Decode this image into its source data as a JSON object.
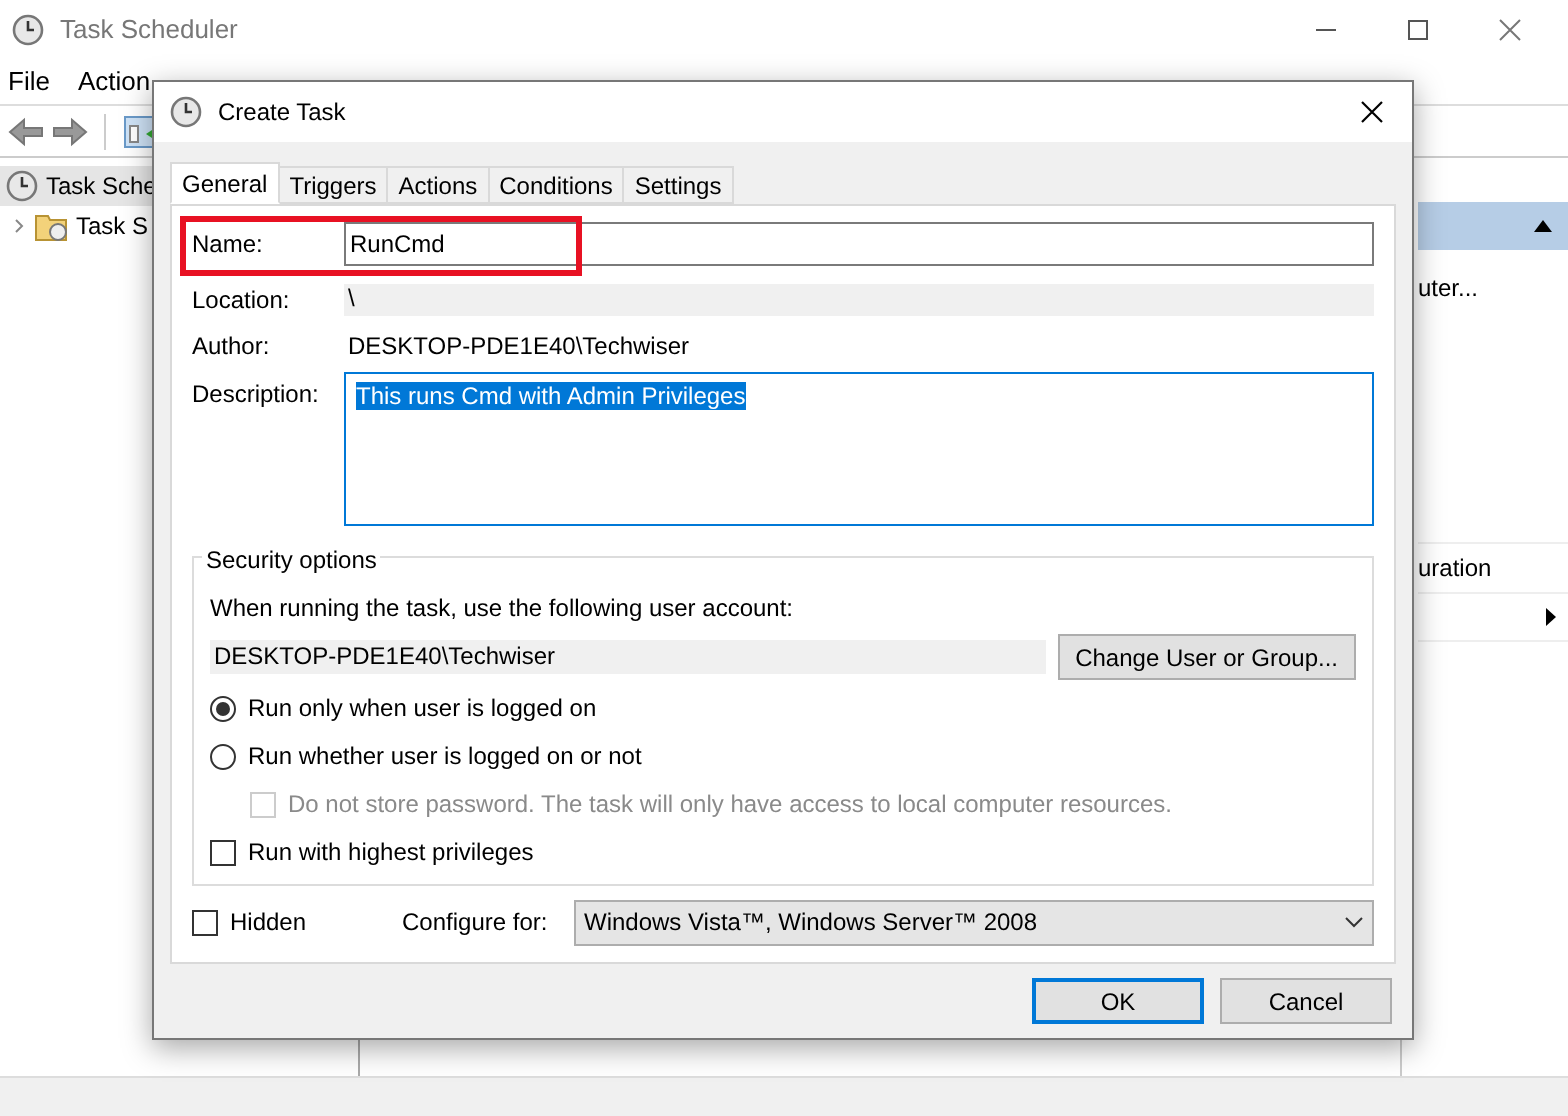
{
  "app": {
    "title": "Task Scheduler",
    "menu": [
      "File",
      "Action"
    ],
    "tree": {
      "label": "Task Sche",
      "selected": true,
      "children": [
        {
          "label": "Task S",
          "expanded": false
        }
      ]
    },
    "actions_panel": {
      "items": [
        {
          "kind": "text",
          "label": "uter..."
        },
        {
          "kind": "text",
          "label": "uration"
        },
        {
          "kind": "submenu"
        }
      ]
    }
  },
  "dialog": {
    "title": "Create Task",
    "tabs": [
      {
        "label": "General",
        "selected": true
      },
      {
        "label": "Triggers",
        "selected": false
      },
      {
        "label": "Actions",
        "selected": false
      },
      {
        "label": "Conditions",
        "selected": false
      },
      {
        "label": "Settings",
        "selected": false
      }
    ],
    "name": {
      "label": "Name:",
      "value": "RunCmd",
      "highlighted": true
    },
    "location": {
      "label": "Location:",
      "value": "\\"
    },
    "author": {
      "label": "Author:",
      "value": "DESKTOP-PDE1E40\\Techwiser"
    },
    "description": {
      "label": "Description:",
      "value": "This runs Cmd with Admin Privileges",
      "selected": true
    },
    "security": {
      "title": "Security options",
      "prompt": "When running the task, use the following user account:",
      "account": "DESKTOP-PDE1E40\\Techwiser",
      "button": "Change User or Group...",
      "options": [
        {
          "kind": "radio",
          "label": "Run only when user is logged on",
          "selected": true
        },
        {
          "kind": "radio",
          "label": "Run whether user is logged on or not",
          "selected": false,
          "children": [
            {
              "kind": "checkbox",
              "label": "Do not store password.  The task will only have access to local computer resources.",
              "checked": false,
              "disabled": true
            }
          ]
        },
        {
          "kind": "checkbox",
          "label": "Run with highest privileges",
          "checked": false,
          "disabled": false
        }
      ]
    },
    "hidden": {
      "label": "Hidden",
      "checked": false
    },
    "configure": {
      "label": "Configure for:",
      "value": "Windows Vista™, Windows Server™ 2008"
    },
    "buttons": [
      {
        "label": "OK",
        "default": true
      },
      {
        "label": "Cancel",
        "default": false
      }
    ]
  }
}
